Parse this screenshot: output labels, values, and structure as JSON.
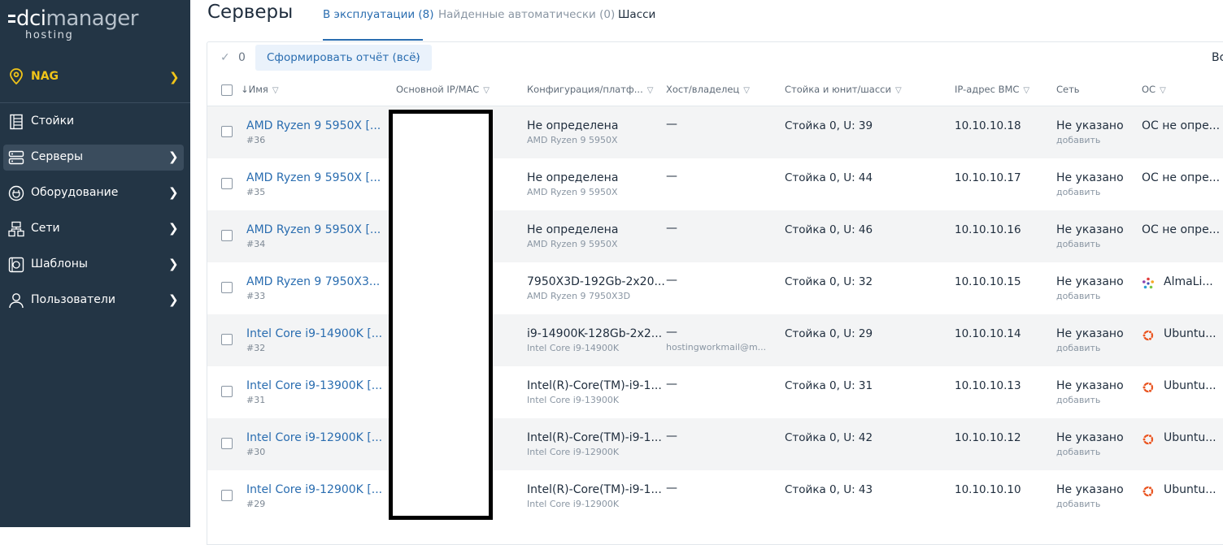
{
  "sidebar": {
    "logo": {
      "brand_a": "dci",
      "brand_b": "manager",
      "sub": "hosting"
    },
    "org": {
      "name": "NAG",
      "icon": "map-pin-icon"
    },
    "items": [
      {
        "label": "Стойки",
        "icon": "rack-icon",
        "chevron": false,
        "active": false
      },
      {
        "label": "Серверы",
        "icon": "server-icon",
        "chevron": true,
        "active": true
      },
      {
        "label": "Оборудование",
        "icon": "plug-icon",
        "chevron": true,
        "active": false
      },
      {
        "label": "Сети",
        "icon": "network-icon",
        "chevron": true,
        "active": false
      },
      {
        "label": "Шаблоны",
        "icon": "template-icon",
        "chevron": true,
        "active": false
      },
      {
        "label": "Пользователи",
        "icon": "user-icon",
        "chevron": true,
        "active": false
      }
    ]
  },
  "header": {
    "title": "Серверы",
    "tabs": [
      {
        "label": "В эксплуатации (8)",
        "active": true
      },
      {
        "label": "Найденные автоматически (0)",
        "active": false
      },
      {
        "label": "Шасси",
        "active": false
      }
    ]
  },
  "toolbar": {
    "selected_count": "0",
    "report_button": "Сформировать отчёт (всё)",
    "right_cut": "Вс"
  },
  "table": {
    "columns": [
      "↓Имя",
      "Основной IP/MAC",
      "Конфигурация/платф...",
      "Хост/владелец",
      "Стойка и юнит/шасси",
      "IP-адрес BMC",
      "Сеть",
      "ОС"
    ],
    "rows": [
      {
        "name": "AMD Ryzen 9 5950X [...",
        "id": "#36",
        "config": "Не определена",
        "platform": "AMD Ryzen 9 5950X",
        "host": "—",
        "owner": "",
        "rack": "Стойка 0, U: 39",
        "bmc": "10.10.10.18",
        "net": "Не указано",
        "net_add": "добавить",
        "os": "ОС не опре...",
        "os_icon": ""
      },
      {
        "name": "AMD Ryzen 9 5950X [...",
        "id": "#35",
        "config": "Не определена",
        "platform": "AMD Ryzen 9 5950X",
        "host": "—",
        "owner": "",
        "rack": "Стойка 0, U: 44",
        "bmc": "10.10.10.17",
        "net": "Не указано",
        "net_add": "добавить",
        "os": "ОС не опре...",
        "os_icon": ""
      },
      {
        "name": "AMD Ryzen 9 5950X [...",
        "id": "#34",
        "config": "Не определена",
        "platform": "AMD Ryzen 9 5950X",
        "host": "—",
        "owner": "",
        "rack": "Стойка 0, U: 46",
        "bmc": "10.10.10.16",
        "net": "Не указано",
        "net_add": "добавить",
        "os": "ОС не опре...",
        "os_icon": ""
      },
      {
        "name": "AMD Ryzen 9 7950X3...",
        "id": "#33",
        "config": "7950X3D-192Gb-2x20...",
        "platform": "AMD Ryzen 9 7950X3D",
        "host": "—",
        "owner": "",
        "rack": "Стойка 0, U: 32",
        "bmc": "10.10.10.15",
        "net": "Не указано",
        "net_add": "добавить",
        "os": "AlmaLi...",
        "os_icon": "almalinux-icon"
      },
      {
        "name": "Intel Core i9-14900K [...",
        "id": "#32",
        "config": "i9-14900K-128Gb-2x2...",
        "platform": "Intel Core i9-14900K",
        "host": "—",
        "owner": "hostingworkmail@m...",
        "rack": "Стойка 0, U: 29",
        "bmc": "10.10.10.14",
        "net": "Не указано",
        "net_add": "добавить",
        "os": "Ubuntu...",
        "os_icon": "ubuntu-icon"
      },
      {
        "name": "Intel Core i9-13900K [...",
        "id": "#31",
        "config": "Intel(R)-Core(TM)-i9-1...",
        "platform": "Intel Core i9-13900K",
        "host": "—",
        "owner": "",
        "rack": "Стойка 0, U: 31",
        "bmc": "10.10.10.13",
        "net": "Не указано",
        "net_add": "добавить",
        "os": "Ubuntu...",
        "os_icon": "ubuntu-icon"
      },
      {
        "name": "Intel Core i9-12900K [...",
        "id": "#30",
        "config": "Intel(R)-Core(TM)-i9-1...",
        "platform": "Intel Core i9-12900K",
        "host": "—",
        "owner": "",
        "rack": "Стойка 0, U: 42",
        "bmc": "10.10.10.12",
        "net": "Не указано",
        "net_add": "добавить",
        "os": "Ubuntu...",
        "os_icon": "ubuntu-icon"
      },
      {
        "name": "Intel Core i9-12900K [...",
        "id": "#29",
        "config": "Intel(R)-Core(TM)-i9-1...",
        "platform": "Intel Core i9-12900K",
        "host": "—",
        "owner": "",
        "rack": "Стойка 0, U: 43",
        "bmc": "10.10.10.10",
        "net": "Не указано",
        "net_add": "добавить",
        "os": "Ubuntu...",
        "os_icon": "ubuntu-icon"
      }
    ]
  },
  "colors": {
    "sidebar_bg": "#233545",
    "accent": "#2a6db0",
    "org_accent": "#f0c419",
    "row_alt": "#f3f4f5"
  }
}
